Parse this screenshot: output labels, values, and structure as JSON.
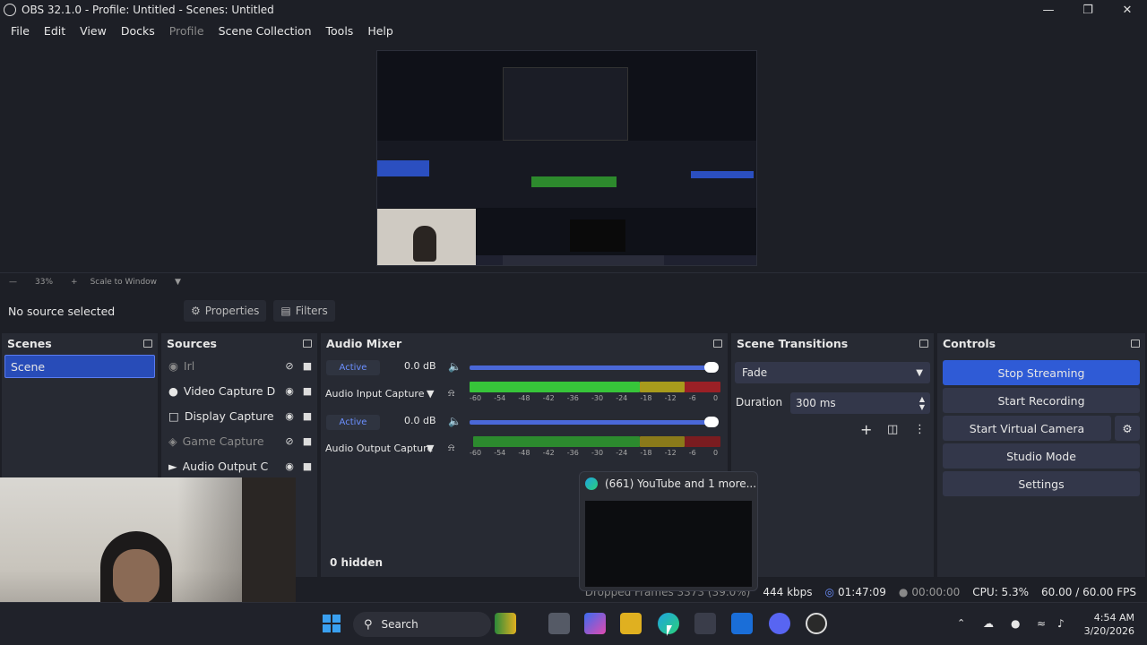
{
  "window": {
    "title": "OBS 32.1.0 - Profile: Untitled - Scenes: Untitled"
  },
  "menu": [
    "File",
    "Edit",
    "View",
    "Docks",
    "Profile",
    "Scene Collection",
    "Tools",
    "Help"
  ],
  "preview": {
    "zoom": "33%",
    "scale_mode": "Scale to Window"
  },
  "source_toolbar": {
    "no_source": "No source selected",
    "properties": "Properties",
    "filters": "Filters"
  },
  "scenes": {
    "title": "Scenes",
    "items": [
      "Scene"
    ]
  },
  "sources": {
    "title": "Sources",
    "items": [
      "Irl",
      "Video Capture D",
      "Display Capture",
      "Game Capture",
      "Audio Output C"
    ]
  },
  "mixer": {
    "title": "Audio Mixer",
    "channels": [
      {
        "name": "Audio Input Capture",
        "db": "0.0 dB",
        "status": "Active"
      },
      {
        "name": "Audio Output Capture",
        "db": "0.0 dB",
        "status": "Active"
      }
    ],
    "scale": [
      "-60",
      "-54",
      "-48",
      "-42",
      "-36",
      "-30",
      "-24",
      "-18",
      "-12",
      "-6",
      "0"
    ],
    "hidden": "0 hidden"
  },
  "transitions": {
    "title": "Scene Transitions",
    "selected": "Fade",
    "duration_label": "Duration",
    "duration_value": "300 ms"
  },
  "controls": {
    "title": "Controls",
    "stop_streaming": "Stop Streaming",
    "start_recording": "Start Recording",
    "start_virtual_camera": "Start Virtual Camera",
    "studio_mode": "Studio Mode",
    "settings": "Settings"
  },
  "status": {
    "dropped": "Dropped Frames 3373 (39.0%)",
    "bitrate": "444 kbps",
    "stream_time": "01:47:09",
    "rec_time": "00:00:00",
    "cpu": "CPU: 5.3%",
    "fps": "60.00 / 60.00 FPS"
  },
  "taskbar_popup": {
    "title": "(661) YouTube and 1 more..."
  },
  "taskbar": {
    "search": "Search",
    "time": "4:54 AM",
    "date": "3/20/2026"
  },
  "colors": {
    "accent": "#284cb8",
    "stop_streaming": "#2f5bd6",
    "meter_green": "#37c53a",
    "meter_yellow": "#b8a320",
    "meter_red": "#b5242a"
  }
}
